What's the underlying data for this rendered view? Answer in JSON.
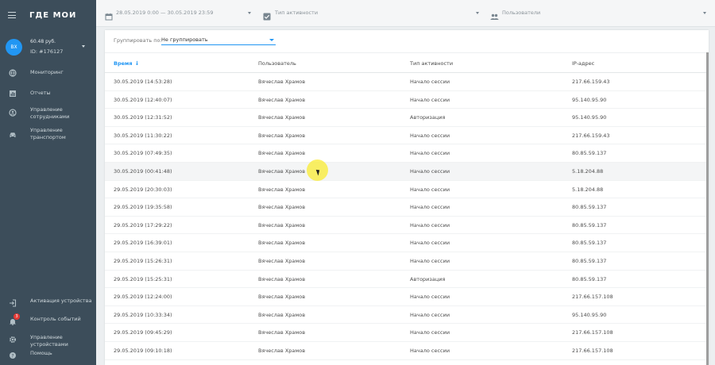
{
  "app": {
    "logo": "ГДЕ МОИ"
  },
  "account": {
    "initials": "ВХ",
    "balance": "60.48 руб.",
    "id": "ID: #176127"
  },
  "sidebar": {
    "top_items": [
      {
        "label": "Мониторинг",
        "icon": "globe-icon"
      },
      {
        "label": "Отчеты",
        "icon": "chart-icon"
      },
      {
        "label": "Управление сотрудниками",
        "icon": "location-person-icon"
      },
      {
        "label": "Управление транспортом",
        "icon": "car-icon"
      }
    ],
    "bottom_items": [
      {
        "label": "Активация устройства",
        "icon": "login-icon"
      },
      {
        "label": "Контроль событий",
        "icon": "bell-icon",
        "badge": "3"
      },
      {
        "label": "Управление устройствами",
        "icon": "gear-icon"
      },
      {
        "label": "Помощь",
        "icon": "help-icon"
      }
    ]
  },
  "filters": {
    "date_range": "28.05.2019 0:00 — 30.05.2019 23:59",
    "activity_type": "Тип активности",
    "users": "Пользователи"
  },
  "groupby": {
    "label": "Группировать по:",
    "value": "Не группировать"
  },
  "table": {
    "columns": [
      "Время",
      "Пользователь",
      "Тип активности",
      "IP-адрес"
    ],
    "rows": [
      [
        "30.05.2019 (14:53:28)",
        "Вячеслав Храмов",
        "Начало сессии",
        "217.66.159.43"
      ],
      [
        "30.05.2019 (12:40:07)",
        "Вячеслав Храмов",
        "Начало сессии",
        "95.140.95.90"
      ],
      [
        "30.05.2019 (12:31:52)",
        "Вячеслав Храмов",
        "Авторизация",
        "95.140.95.90"
      ],
      [
        "30.05.2019 (11:30:22)",
        "Вячеслав Храмов",
        "Начало сессии",
        "217.66.159.43"
      ],
      [
        "30.05.2019 (07:49:35)",
        "Вячеслав Храмов",
        "Начало сессии",
        "80.85.59.137"
      ],
      [
        "30.05.2019 (00:41:48)",
        "Вячеслав Храмов",
        "Начало сессии",
        "5.18.204.88"
      ],
      [
        "29.05.2019 (20:30:03)",
        "Вячеслав Храмов",
        "Начало сессии",
        "5.18.204.88"
      ],
      [
        "29.05.2019 (19:35:58)",
        "Вячеслав Храмов",
        "Начало сессии",
        "80.85.59.137"
      ],
      [
        "29.05.2019 (17:29:22)",
        "Вячеслав Храмов",
        "Начало сессии",
        "80.85.59.137"
      ],
      [
        "29.05.2019 (16:39:01)",
        "Вячеслав Храмов",
        "Начало сессии",
        "80.85.59.137"
      ],
      [
        "29.05.2019 (15:26:31)",
        "Вячеслав Храмов",
        "Начало сессии",
        "80.85.59.137"
      ],
      [
        "29.05.2019 (15:25:31)",
        "Вячеслав Храмов",
        "Авторизация",
        "80.85.59.137"
      ],
      [
        "29.05.2019 (12:24:00)",
        "Вячеслав Храмов",
        "Начало сессии",
        "217.66.157.108"
      ],
      [
        "29.05.2019 (10:33:34)",
        "Вячеслав Храмов",
        "Начало сессии",
        "95.140.95.90"
      ],
      [
        "29.05.2019 (09:45:29)",
        "Вячеслав Храмов",
        "Начало сессии",
        "217.66.157.108"
      ],
      [
        "29.05.2019 (09:10:18)",
        "Вячеслав Храмов",
        "Начало сессии",
        "217.66.157.108"
      ]
    ]
  },
  "colors": {
    "sidebar_bg": "#3c4d5a",
    "accent": "#2196f3",
    "badge": "#e53935"
  }
}
